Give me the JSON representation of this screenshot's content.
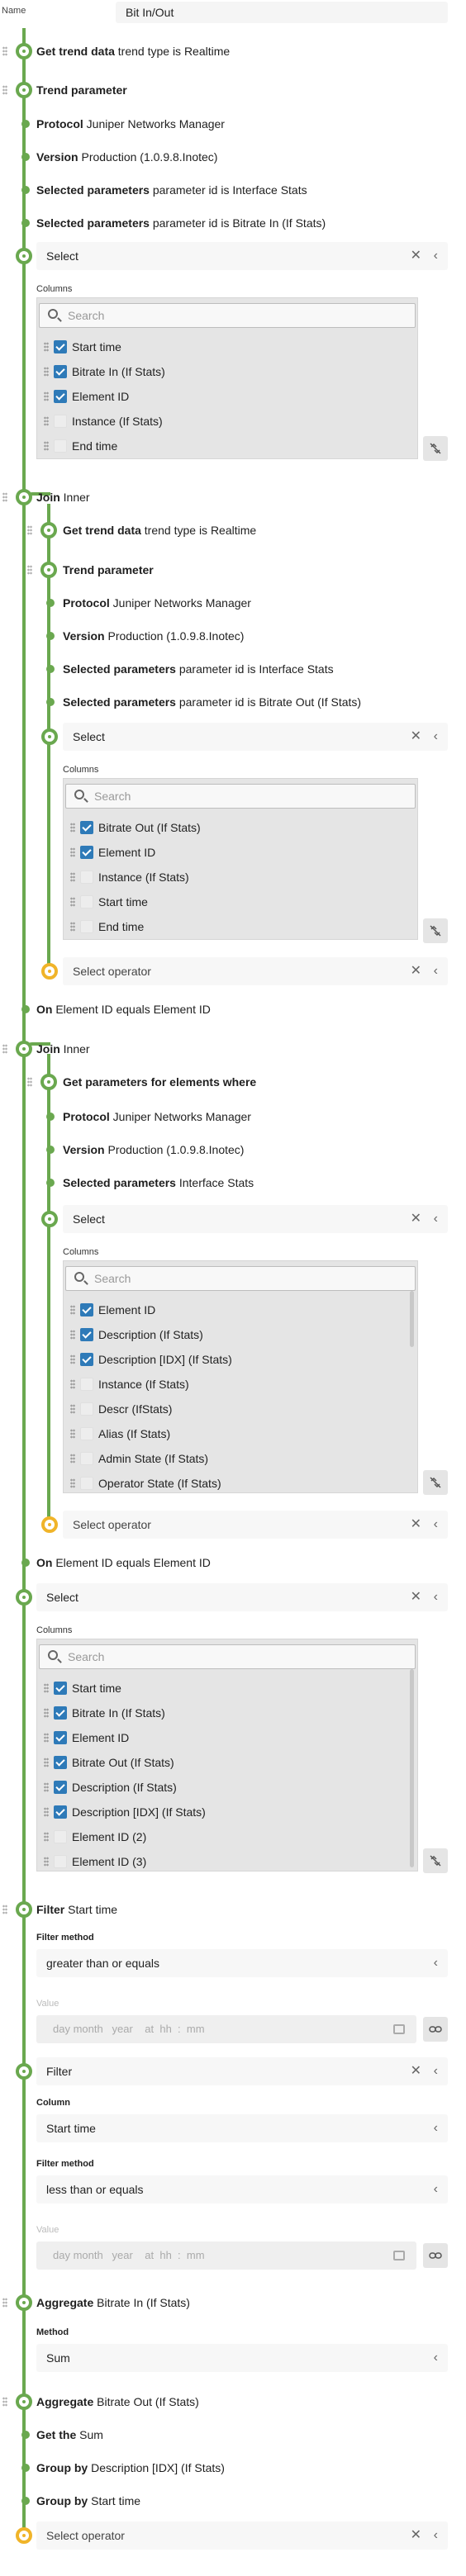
{
  "name_label": "Name",
  "name_value": "Bit In/Out",
  "steps": {
    "trend1": {
      "key": "Get trend data",
      "val": "trend type is Realtime"
    },
    "trendp1": {
      "key": "Trend parameter",
      "val": ""
    },
    "proto1": {
      "key": "Protocol",
      "val": "Juniper Networks Manager"
    },
    "ver1": {
      "key": "Version",
      "val": "Production (1.0.9.8.Inotec)"
    },
    "selp1a": {
      "key": "Selected parameters",
      "val": "parameter id is Interface Stats"
    },
    "selp1b": {
      "key": "Selected parameters",
      "val": "parameter id is Bitrate In (If Stats)"
    },
    "join1": {
      "key": "Join",
      "val": "Inner"
    },
    "trend2": {
      "key": "Get trend data",
      "val": "trend type is Realtime"
    },
    "trendp2": {
      "key": "Trend parameter",
      "val": ""
    },
    "proto2": {
      "key": "Protocol",
      "val": "Juniper Networks Manager"
    },
    "ver2": {
      "key": "Version",
      "val": "Production (1.0.9.8.Inotec)"
    },
    "selp2a": {
      "key": "Selected parameters",
      "val": "parameter id is Interface Stats"
    },
    "selp2b": {
      "key": "Selected parameters",
      "val": "parameter id is Bitrate Out (If Stats)"
    },
    "on1": {
      "key": "On",
      "val": "Element ID equals Element ID"
    },
    "join2": {
      "key": "Join",
      "val": "Inner"
    },
    "getp": {
      "key": "Get parameters for elements where",
      "val": ""
    },
    "proto3": {
      "key": "Protocol",
      "val": "Juniper Networks Manager"
    },
    "ver3": {
      "key": "Version",
      "val": "Production (1.0.9.8.Inotec)"
    },
    "selp3": {
      "key": "Selected parameters",
      "val": "Interface Stats"
    },
    "on2": {
      "key": "On",
      "val": "Element ID equals Element ID"
    },
    "filter1": {
      "key": "Filter",
      "val": "Start time"
    },
    "agg1": {
      "key": "Aggregate",
      "val": "Bitrate In (If Stats)"
    },
    "agg2": {
      "key": "Aggregate",
      "val": "Bitrate Out (If Stats)"
    },
    "getsum": {
      "key": "Get the",
      "val": "Sum"
    },
    "group1": {
      "key": "Group by",
      "val": "Description [IDX] (If Stats)"
    },
    "group2": {
      "key": "Group by",
      "val": "Start time"
    }
  },
  "select_label": "Select",
  "select_operator": "Select operator",
  "filter_label": "Filter",
  "columns_label": "Columns",
  "search_placeholder": "Search",
  "close_glyph": "✕",
  "chevron_glyph": "‹",
  "colsA": [
    {
      "label": "Start time",
      "checked": true
    },
    {
      "label": "Bitrate In (If Stats)",
      "checked": true
    },
    {
      "label": "Element ID",
      "checked": true
    },
    {
      "label": "Instance (If Stats)",
      "checked": false
    },
    {
      "label": "End time",
      "checked": false
    }
  ],
  "colsB": [
    {
      "label": "Bitrate Out (If Stats)",
      "checked": true
    },
    {
      "label": "Element ID",
      "checked": true
    },
    {
      "label": "Instance (If Stats)",
      "checked": false
    },
    {
      "label": "Start time",
      "checked": false
    },
    {
      "label": "End time",
      "checked": false
    }
  ],
  "colsC": [
    {
      "label": "Element ID",
      "checked": true
    },
    {
      "label": "Description (If Stats)",
      "checked": true
    },
    {
      "label": "Description [IDX] (If Stats)",
      "checked": true
    },
    {
      "label": "Instance (If Stats)",
      "checked": false
    },
    {
      "label": "Descr (IfStats)",
      "checked": false
    },
    {
      "label": "Alias (If Stats)",
      "checked": false
    },
    {
      "label": "Admin State (If Stats)",
      "checked": false
    },
    {
      "label": "Operator State (If Stats)",
      "checked": false
    }
  ],
  "colsD": [
    {
      "label": "Start time",
      "checked": true
    },
    {
      "label": "Bitrate In (If Stats)",
      "checked": true
    },
    {
      "label": "Element ID",
      "checked": true
    },
    {
      "label": "Bitrate Out (If Stats)",
      "checked": true
    },
    {
      "label": "Description (If Stats)",
      "checked": true
    },
    {
      "label": "Description [IDX] (If Stats)",
      "checked": true
    },
    {
      "label": "Element ID (2)",
      "checked": false
    },
    {
      "label": "Element ID (3)",
      "checked": false
    }
  ],
  "filter_method_label": "Filter method",
  "value_label": "Value",
  "column_label": "Column",
  "method_label": "Method",
  "filter1_method": "greater than or equals",
  "filter2_column": "Start time",
  "filter2_method": "less than or equals",
  "date_placeholder": "day month   year    at  hh  :  mm",
  "agg1_method": "Sum",
  "colors": {
    "accent": "#6aa84f",
    "pending": "#f0b429",
    "checkbox": "#2e7ab8"
  }
}
